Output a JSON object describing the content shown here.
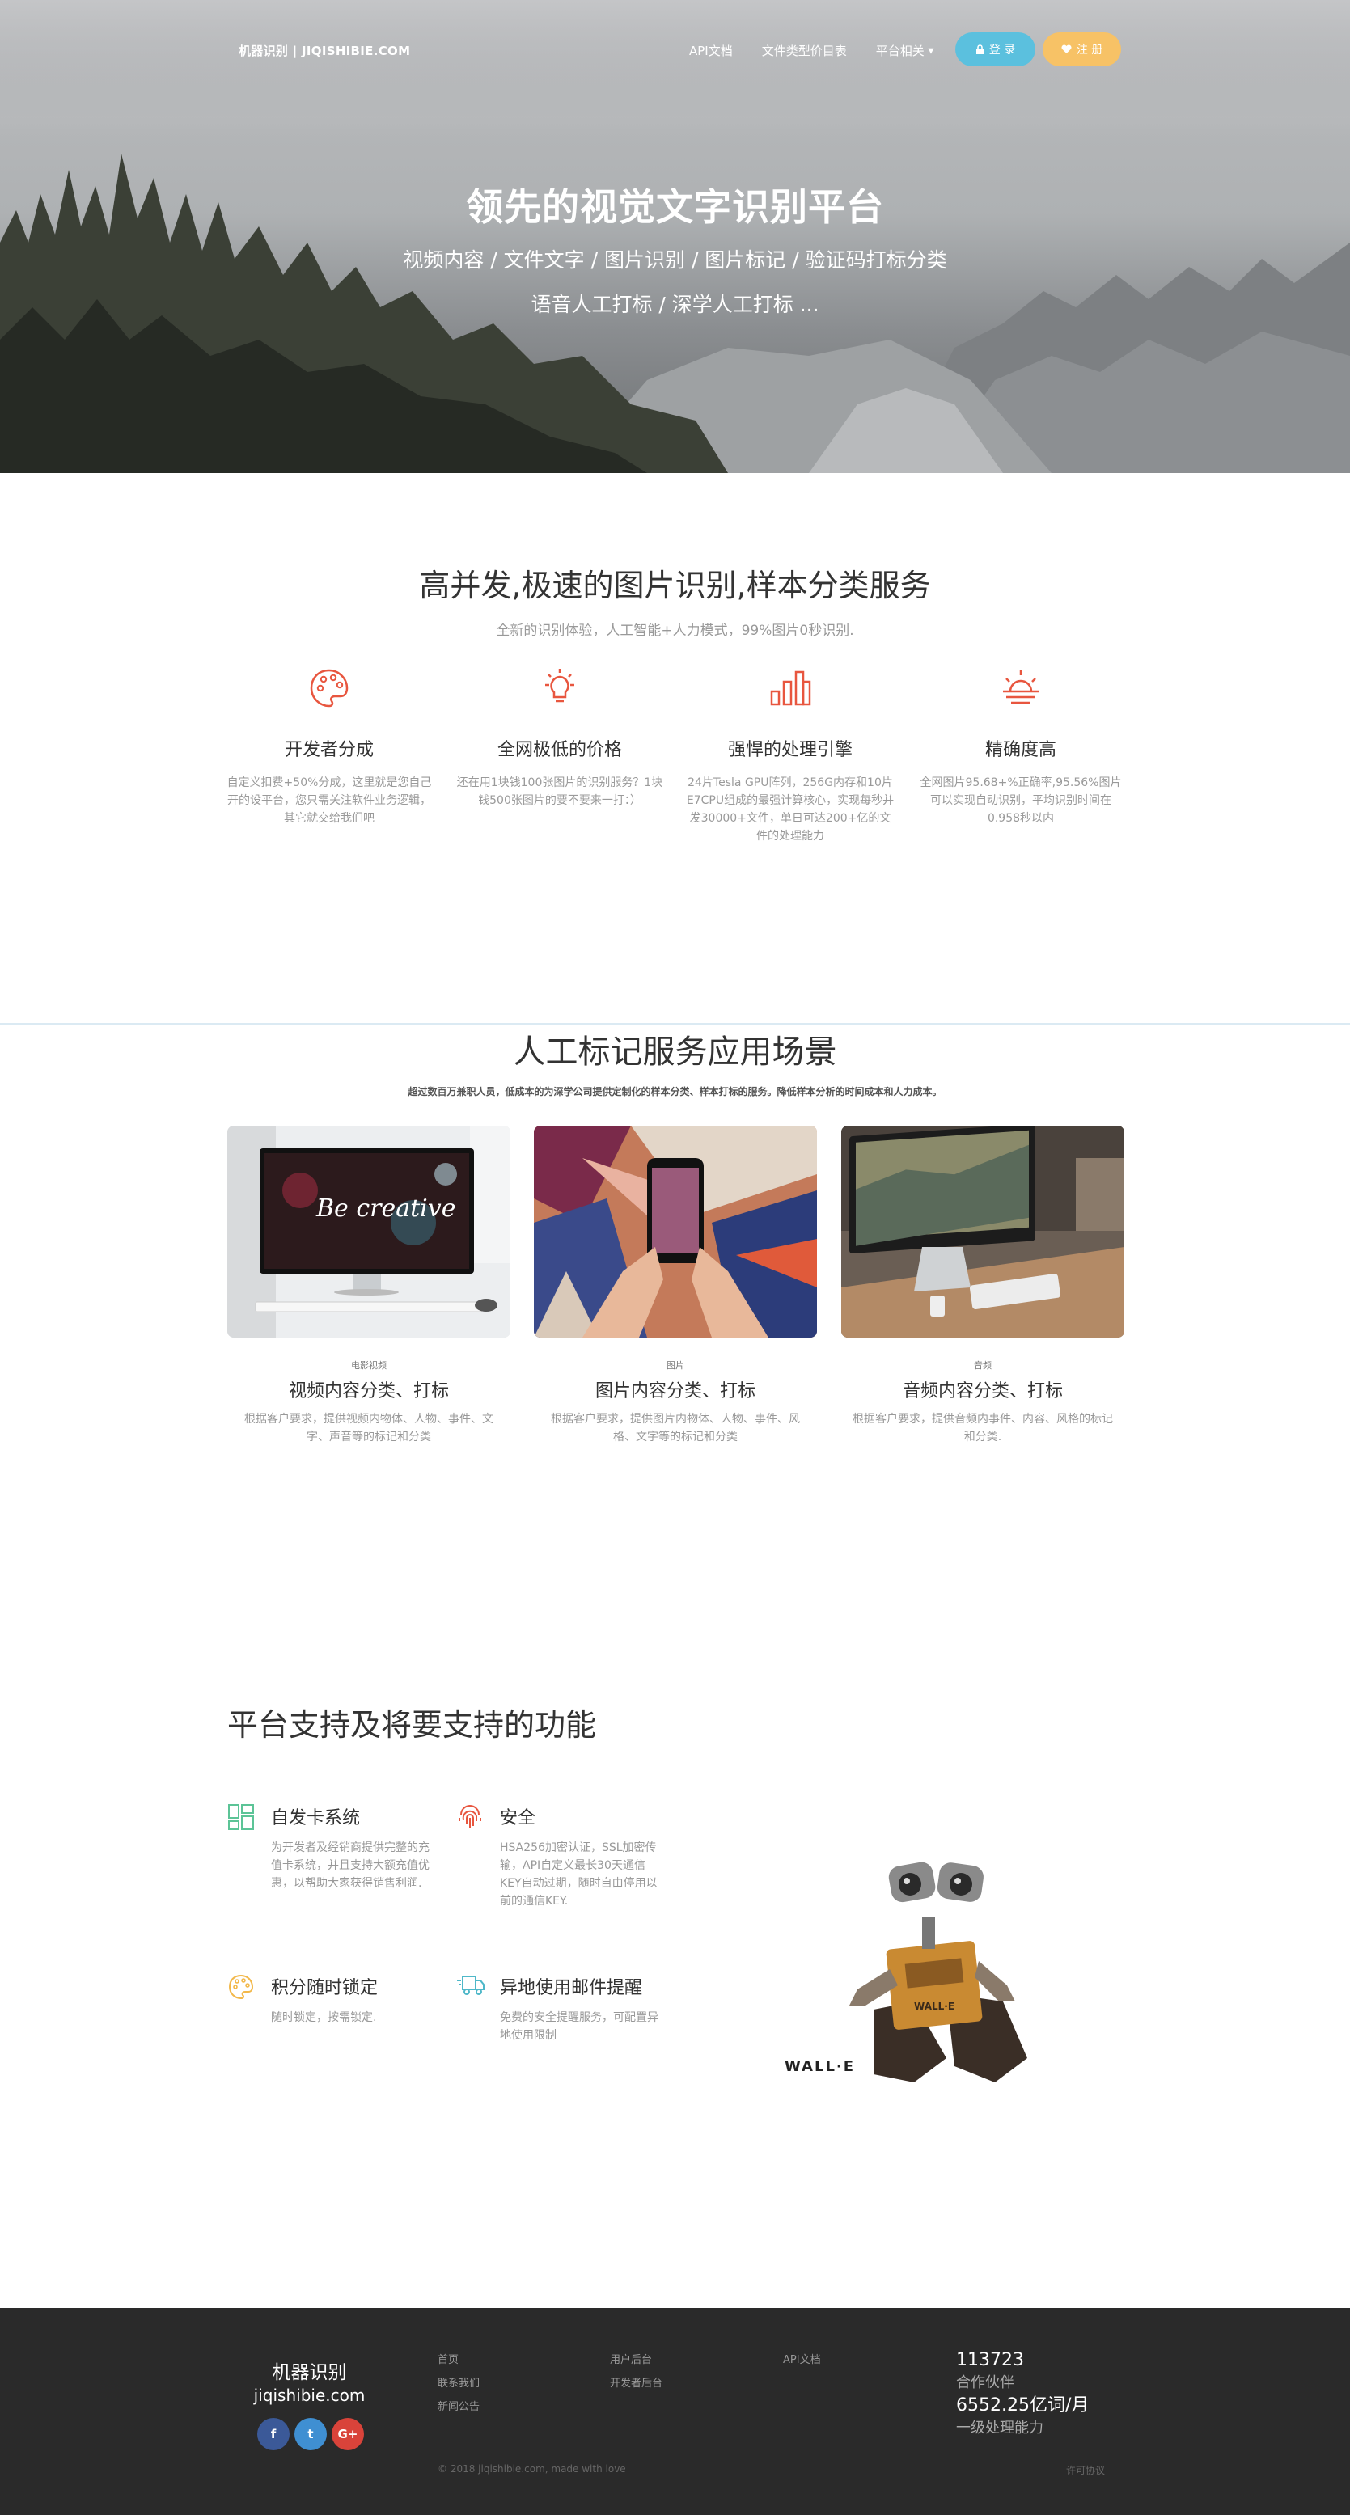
{
  "nav": {
    "brand": "机器识别 | JIQISHIBIE.COM",
    "links": [
      "API文档",
      "文件类型价目表",
      "平台相关"
    ],
    "login": "登 录",
    "register": "注 册"
  },
  "hero": {
    "title": "领先的视觉文字识别平台",
    "subtitle1": "视频内容 / 文件文字 / 图片识别 / 图片标记 / 验证码打标分类",
    "subtitle2": "语音人工打标 / 深学人工打标 ..."
  },
  "features": {
    "title": "高并发,极速的图片识别,样本分类服务",
    "lead": "全新的识别体验，人工智能+人力模式，99%图片0秒识别.",
    "items": [
      {
        "icon": "palette-icon",
        "title": "开发者分成",
        "text": "自定义扣费+50%分成，这里就是您自己开的设平台，您只需关注软件业务逻辑，其它就交给我们吧"
      },
      {
        "icon": "lightbulb-icon",
        "title": "全网极低的价格",
        "text": "还在用1块钱100张图片的识别服务？1块钱500张图片的要不要来一打：）"
      },
      {
        "icon": "bar-chart-icon",
        "title": "强悍的处理引擎",
        "text": "24片Tesla GPU阵列，256G内存和10片E7CPU组成的最强计算核心，实现每秒并发30000+文件，单日可达200+亿的文件的处理能力"
      },
      {
        "icon": "sunrise-icon",
        "title": "精确度高",
        "text": "全网图片95.68+%正确率,95.56%图片可以实现自动识别，平均识别时间在0.958秒以内"
      }
    ],
    "accent": "#e8563f"
  },
  "scenarios": {
    "title": "人工标记服务应用场景",
    "lead": "超过数百万兼职人员，低成本的为深学公司提供定制化的样本分类、样本打标的服务。降低样本分析的时间成本和人力成本。",
    "cards": [
      {
        "category": "电影视频",
        "title": "视频内容分类、打标",
        "text": "根据客户要求，提供视频内物体、人物、事件、文字、声音等的标记和分类"
      },
      {
        "category": "图片",
        "title": "图片内容分类、打标",
        "text": "根据客户要求，提供图片内物体、人物、事件、风格、文字等的标记和分类"
      },
      {
        "category": "音频",
        "title": "音频内容分类、打标",
        "text": "根据客户要求，提供音频内事件、内容、风格的标记和分类."
      }
    ]
  },
  "platform": {
    "title": "平台支持及将要支持的功能",
    "items": [
      {
        "icon": "dashboard-icon",
        "title": "自发卡系统",
        "text": "为开发者及经销商提供完整的充值卡系统，并且支持大额充值优惠，以帮助大家获得销售利润."
      },
      {
        "icon": "fingerprint-icon",
        "title": "安全",
        "text": "HSA256加密认证，SSL加密传输，API自定义最长30天通信KEY自动过期，随时自由停用以前的通信KEY."
      },
      {
        "icon": "palette-icon",
        "title": "积分随时锁定",
        "text": "随时锁定，按需锁定."
      },
      {
        "icon": "delivery-truck-icon",
        "title": "异地使用邮件提醒",
        "text": "免费的安全提醒服务，可配置异地使用限制"
      }
    ],
    "walle_label": "WALL·E"
  },
  "footer": {
    "name": "机器识别",
    "domain": "jiqishibie.com",
    "col1": [
      "首页",
      "联系我们",
      "新闻公告"
    ],
    "col2": [
      "用户后台",
      "开发者后台"
    ],
    "col3": [
      "API文档"
    ],
    "stat1_value": "113723",
    "stat1_label": "合作伙伴",
    "stat2_value": "6552.25亿词/月",
    "stat2_label": "一级处理能力",
    "copyright": "© 2018 jiqishibie.com, made with love",
    "license": "许可协议"
  }
}
